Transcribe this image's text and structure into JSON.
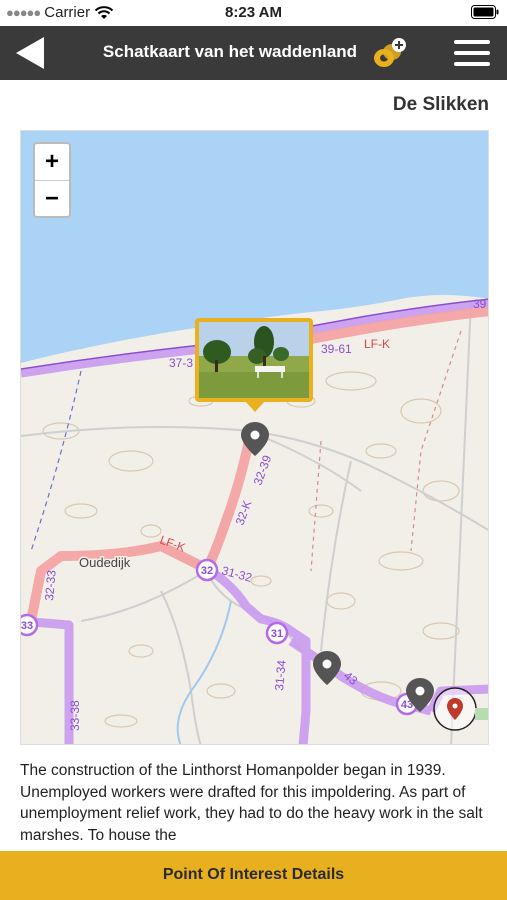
{
  "status_bar": {
    "carrier": "Carrier",
    "time": "8:23 AM"
  },
  "nav": {
    "title": "Schatkaart van het waddenland",
    "back_icon": "back-arrow-icon",
    "coin_icon": "coin-add-icon",
    "menu_icon": "hamburger-menu-icon"
  },
  "poi": {
    "name": "De Slikken"
  },
  "map": {
    "zoom_in": "+",
    "zoom_out": "−",
    "place_label": "Oudedijk",
    "route_labels": {
      "r1": "39-61",
      "r2": "LF-K",
      "r3": "LF-K",
      "r4": "32-K",
      "r5": "32-39",
      "r6": "31-32",
      "r7": "32-33",
      "r8": "33-38",
      "r9": "31-34",
      "r10": "37-3",
      "r11": "39",
      "r12": "43"
    },
    "node_labels": {
      "n32": "32",
      "n33": "33",
      "n31": "31",
      "n43": "43"
    },
    "colors": {
      "water": "#aad3f5",
      "land": "#f2efe9",
      "route_red": "#f3a3a3",
      "route_purple": "#c99af0"
    }
  },
  "description": {
    "text": "The construction of the Linthorst Homanpolder began in 1939. Unemployed workers were drafted for this impoldering. As part of unemployment relief work, they had to do the heavy work in the salt marshes. To house the"
  },
  "details_button": {
    "label": "Point Of Interest Details"
  }
}
